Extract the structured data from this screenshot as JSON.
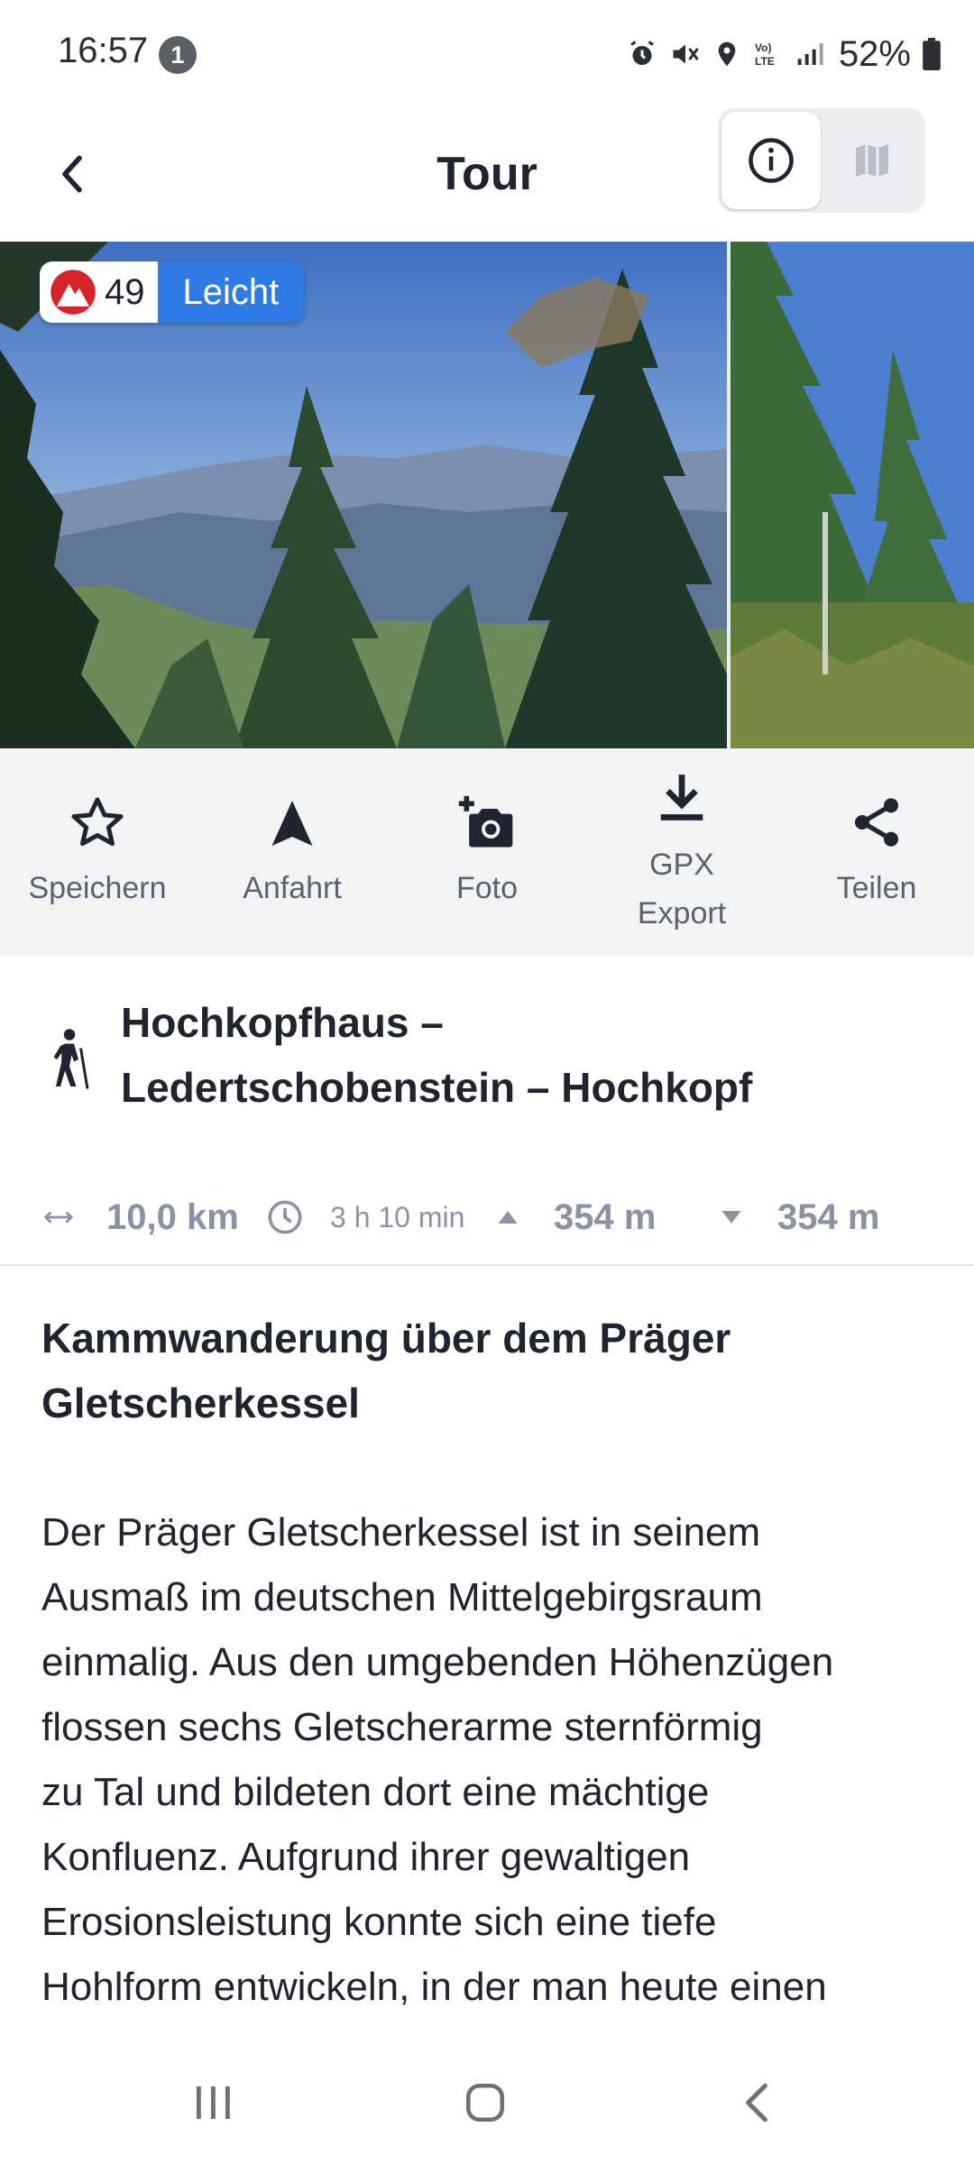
{
  "status_bar": {
    "time": "16:57",
    "notification_count": "1",
    "battery": "52%",
    "icons": [
      "alarm-icon",
      "mute-icon",
      "location-icon",
      "volte-icon",
      "signal-icon",
      "battery-icon"
    ]
  },
  "header": {
    "title": "Tour",
    "back_icon": "chevron-left-icon",
    "toggle_info_icon": "info-icon",
    "toggle_map_icon": "map-icon"
  },
  "gallery": {
    "rating_value": "49",
    "difficulty": "Leicht",
    "difficulty_color": "#2f7be6"
  },
  "actions": [
    {
      "label": "Speichern",
      "icon": "star-icon"
    },
    {
      "label": "Anfahrt",
      "icon": "navigation-arrow-icon"
    },
    {
      "label": "Foto",
      "icon": "add-photo-icon"
    },
    {
      "label": "GPX\nExport",
      "label_line1": "GPX",
      "label_line2": "Export",
      "icon": "download-icon"
    },
    {
      "label": "Teilen",
      "icon": "share-icon"
    }
  ],
  "tour": {
    "title_line1": "Hochkopfhaus –",
    "title_line2": "Ledertschobenstein – Hochkopf",
    "activity_icon": "hiking-icon"
  },
  "stats": {
    "distance": "10,0 km",
    "duration": "3 h 10 min",
    "ascent": "354 m",
    "descent": "354 m"
  },
  "description": {
    "heading_line1": "Kammwanderung über dem Präger",
    "heading_line2": "Gletscherkessel",
    "lines": [
      "Der Präger Gletscherkessel ist in seinem",
      "Ausmaß im deutschen Mittelgebirgsraum",
      "einmalig. Aus den umgebenden Höhenzügen",
      "flossen sechs Gletscherarme sternförmig",
      "zu Tal und bildeten dort eine mächtige",
      "Konfluenz. Aufgrund ihrer gewaltigen",
      "Erosionsleistung konnte sich eine tiefe",
      "Hohlform entwickeln, in der man heute einen"
    ]
  },
  "nav_bar": {
    "recents_icon": "recents-icon",
    "home_icon": "home-icon",
    "back_icon": "back-icon"
  }
}
